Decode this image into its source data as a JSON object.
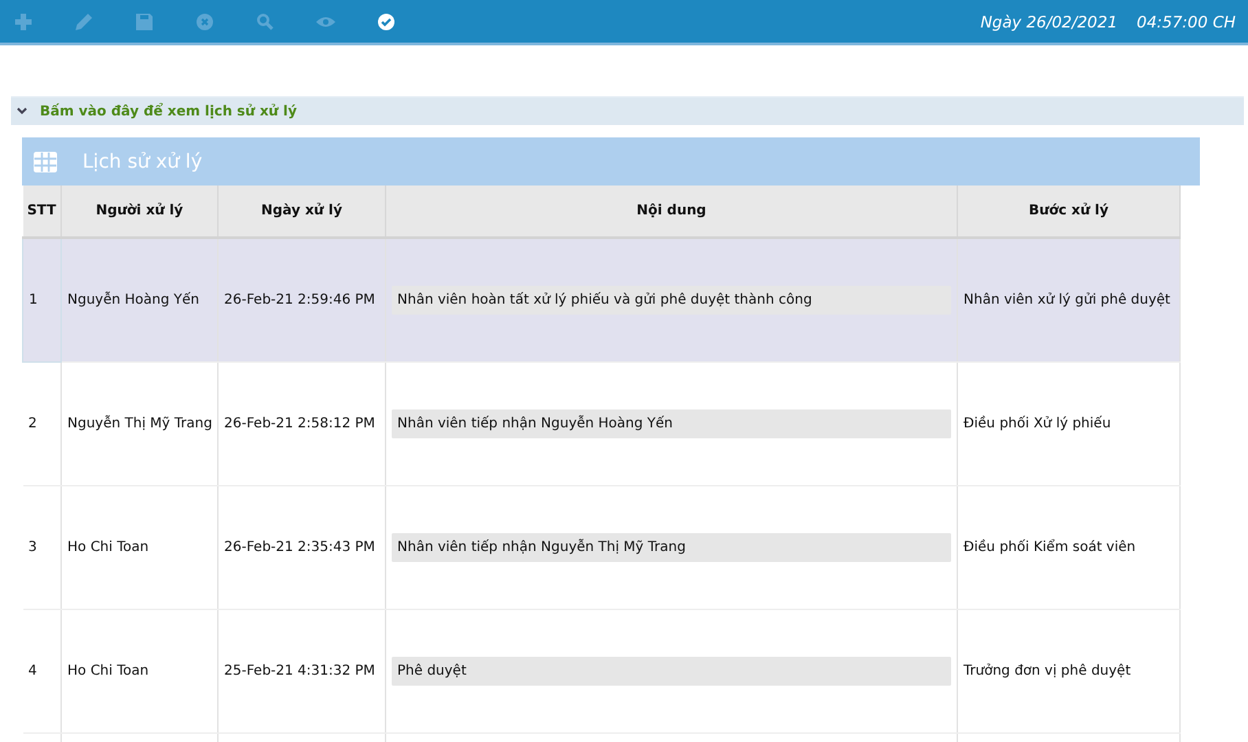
{
  "toolbar": {
    "items": [
      {
        "kind": "add",
        "disabled": true
      },
      {
        "kind": "edit",
        "disabled": true
      },
      {
        "kind": "save",
        "disabled": true
      },
      {
        "kind": "cancel",
        "disabled": true
      },
      {
        "kind": "search",
        "disabled": true
      },
      {
        "kind": "view",
        "disabled": true
      },
      {
        "kind": "approve",
        "disabled": false
      }
    ],
    "date": "Ngày 26/02/2021",
    "time": "04:57:00 CH"
  },
  "history_toggle": {
    "label": "Bấm vào đây để xem lịch sử xử lý",
    "expanded": true
  },
  "panel": {
    "title": "Lịch sử xử lý",
    "table": {
      "columns": [
        "STT",
        "Người xử lý",
        "Ngày xử lý",
        "Nội dung",
        "Bước xử lý"
      ],
      "rows": [
        {
          "cells": [
            "1",
            "Nguyễn Hoàng Yến",
            "26-Feb-21 2:59:46 PM",
            "Nhân viên hoàn tất xử lý phiếu và gửi phê duyệt thành công",
            "Nhân viên xử lý gửi phê duyệt"
          ],
          "selected": true
        },
        {
          "cells": [
            "2",
            "Nguyễn Thị Mỹ Trang",
            "26-Feb-21 2:58:12 PM",
            "Nhân viên tiếp nhận Nguyễn Hoàng Yến",
            "Điều phối Xử lý phiếu"
          ],
          "selected": false
        },
        {
          "cells": [
            "3",
            "Ho Chi Toan",
            "26-Feb-21 2:35:43 PM",
            "Nhân viên tiếp nhận Nguyễn Thị Mỹ Trang",
            "Điều phối Kiểm soát viên"
          ],
          "selected": false
        },
        {
          "cells": [
            "4",
            "Ho Chi Toan",
            "25-Feb-21 4:31:32 PM",
            "Phê duyệt",
            "Trưởng đơn vị phê duyệt"
          ],
          "selected": false
        }
      ]
    }
  }
}
